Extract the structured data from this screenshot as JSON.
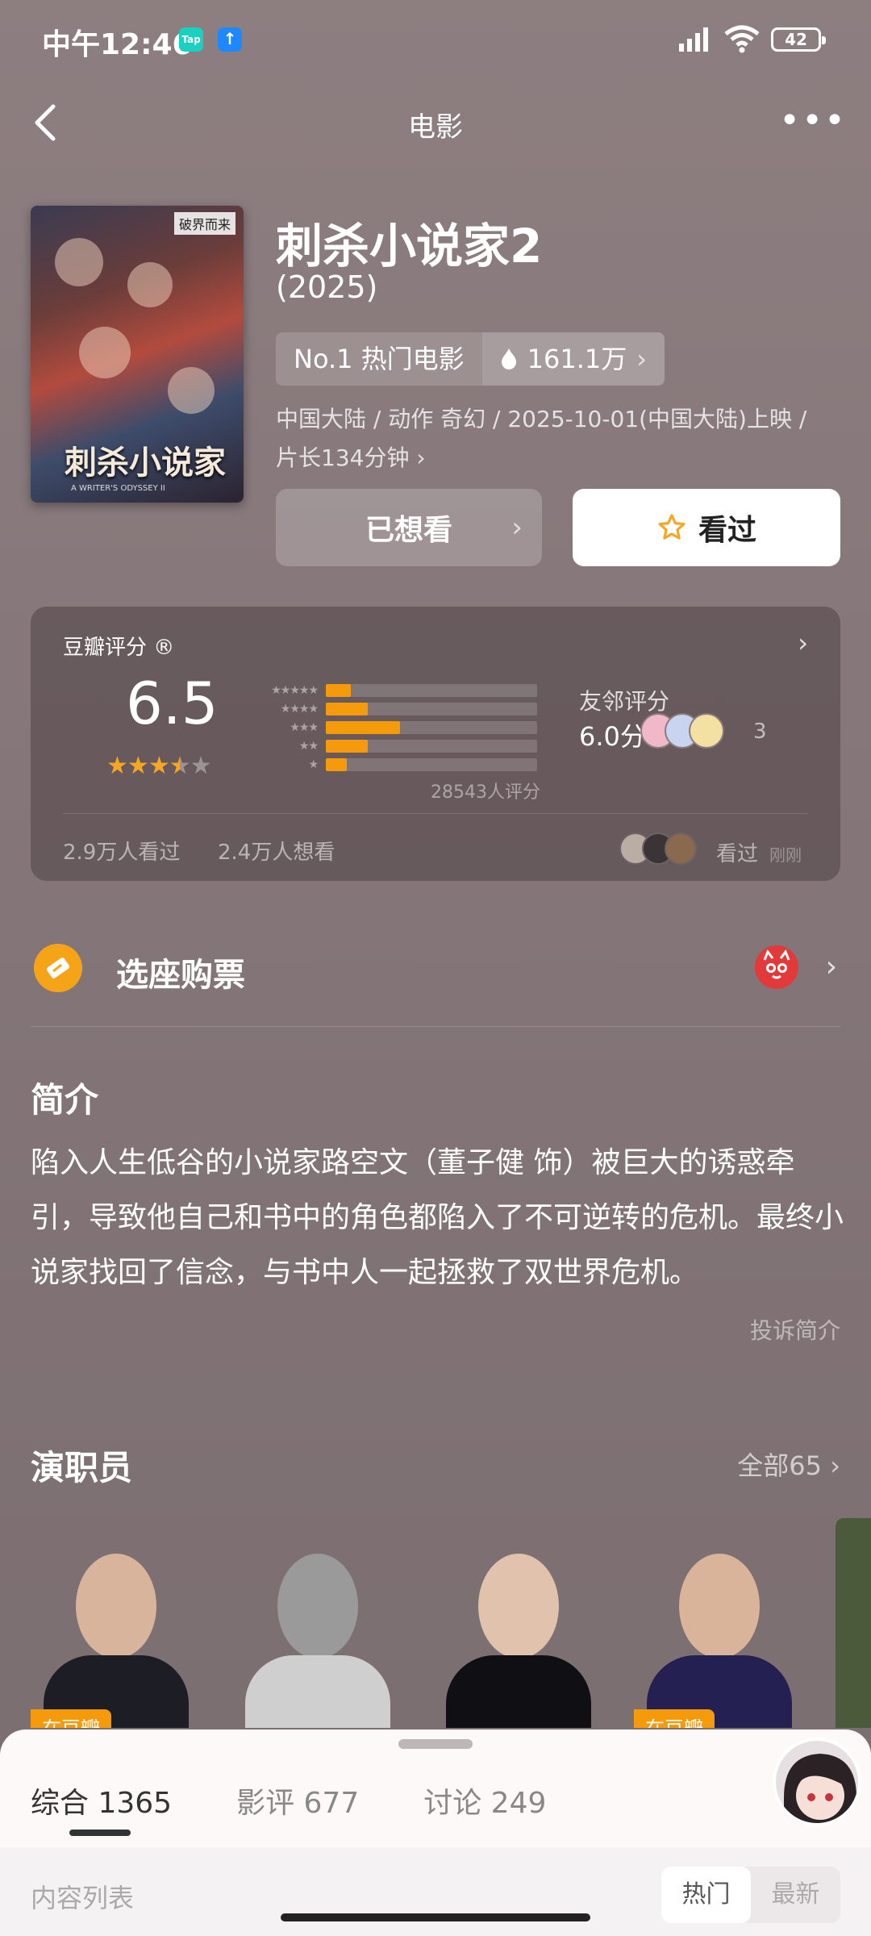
{
  "status_bar": {
    "time": "中午12:46",
    "tap_label": "Tap",
    "upload_label": "↑",
    "battery": "42"
  },
  "nav": {
    "title": "电影",
    "more": "•••"
  },
  "movie": {
    "title": "刺杀小说家2",
    "year": "(2025)",
    "rank_label": "No.1 热门电影",
    "heat": "161.1万",
    "meta_line1": "中国大陆 / 动作 奇幻 / 2025-10-01(中国大陆)上映 /",
    "meta_line2": "片长134分钟 ›",
    "poster_title": "刺杀小说家",
    "poster_badge": "破界而来",
    "poster_sub": "A WRITER'S ODYSSEY II"
  },
  "actions": {
    "want_label": "已想看",
    "seen_label": "看过"
  },
  "rating": {
    "label": "豆瓣评分 ®",
    "score": "6.5",
    "stars_filled": 3.5,
    "distribution": [
      {
        "stars": "★★★★★",
        "percent": 12
      },
      {
        "stars": "★★★★",
        "percent": 20
      },
      {
        "stars": "★★★",
        "percent": 35
      },
      {
        "stars": "★★",
        "percent": 20
      },
      {
        "stars": "★",
        "percent": 10
      }
    ],
    "count": "28543人评分",
    "friend_label": "友邻评分",
    "friend_score": "6.0分",
    "friend_count": "3",
    "seen_count": "2.9万人看过",
    "want_count": "2.4万人想看",
    "my_status": "看过",
    "my_time": "刚刚"
  },
  "tickets": {
    "label": "选座购票"
  },
  "synopsis": {
    "title": "简介",
    "text": "陷入人生低谷的小说家路空文（董子健 饰）被巨大的诱惑牵引，导致他自己和书中的角色都陷入了不可逆转的危机。最终小说家找回了信念，与书中人一起拯救了双世界危机。",
    "report": "投诉简介"
  },
  "cast": {
    "title": "演职员",
    "all_label": "全部65 ›",
    "tag": "在豆瓣",
    "colors": [
      "#d9d9dc",
      "#e8e8e8",
      "#1c1c24",
      "#2a2a44"
    ]
  },
  "sheet": {
    "tabs": [
      {
        "label": "综合 1365"
      },
      {
        "label": "影评 677"
      },
      {
        "label": "讨论 249"
      }
    ],
    "content_label": "内容列表",
    "sort_hot": "热门",
    "sort_new": "最新"
  }
}
